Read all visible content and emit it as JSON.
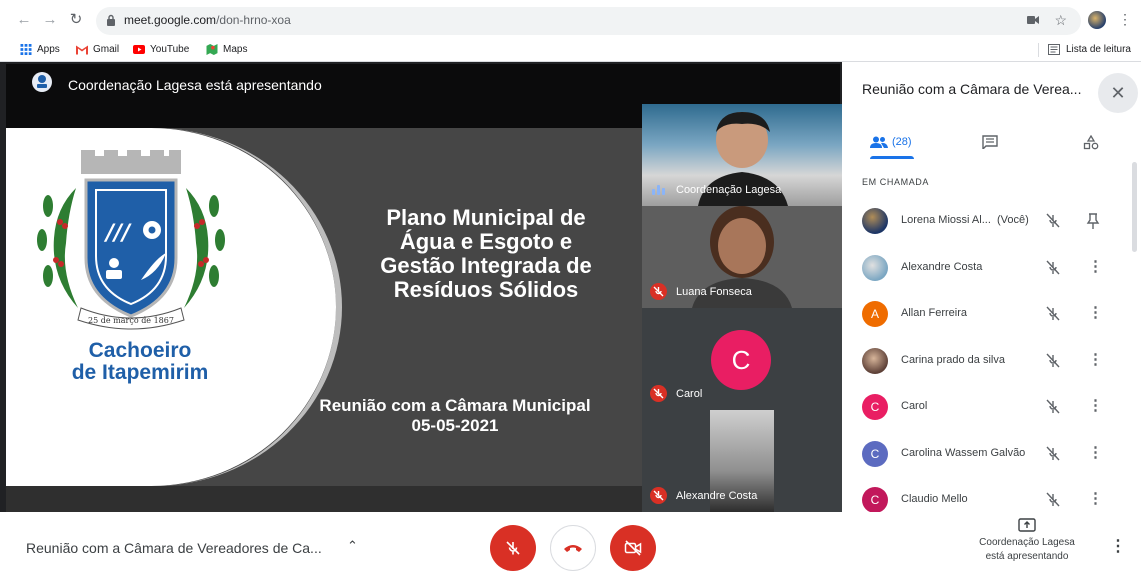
{
  "browser": {
    "url_host": "meet.google.com",
    "url_path": "/don-hrno-xoa",
    "bookmarks": [
      {
        "label": "Apps",
        "icon": "apps-grid-icon"
      },
      {
        "label": "Gmail",
        "icon": "gmail-icon"
      },
      {
        "label": "YouTube",
        "icon": "youtube-icon"
      },
      {
        "label": "Maps",
        "icon": "maps-icon"
      }
    ],
    "reading_list": "Lista de leitura"
  },
  "presentation": {
    "banner": "Coordenação Lagesa está apresentando",
    "city_line1": "Cachoeiro",
    "city_line2": "de Itapemirim",
    "crest_ribbon": "25 de março de 1867",
    "title_lines": [
      "Plano Municipal de",
      "Água e Esgoto e",
      "Gestão Integrada de",
      "Resíduos Sólidos"
    ],
    "subtitle_line1": "Reunião com a Câmara Municipal",
    "subtitle_line2": "05-05-2021"
  },
  "tiles": [
    {
      "name": "Coordenação Lagesa",
      "state": "speaking"
    },
    {
      "name": "Luana Fonseca",
      "state": "muted"
    },
    {
      "name": "Carol",
      "state": "muted",
      "initial": "C",
      "color": "#e91e63"
    },
    {
      "name": "Alexandre Costa",
      "state": "muted"
    }
  ],
  "panel": {
    "title": "Reunião com a Câmara de Verea...",
    "people_count": "(28)",
    "section": "EM CHAMADA",
    "participants": [
      {
        "name": "Lorena Miossi Al...",
        "suffix": "(Você)",
        "avatar": "photo",
        "color": "#1c3566",
        "action": "pin"
      },
      {
        "name": "Alexandre Costa",
        "avatar": "photo",
        "color": "#7aa6c2",
        "action": "more"
      },
      {
        "name": "Allan Ferreira",
        "avatar": "A",
        "color": "#ef6c00",
        "action": "more"
      },
      {
        "name": "Carina prado da silva",
        "avatar": "photo",
        "color": "#8d6e63",
        "action": "more"
      },
      {
        "name": "Carol",
        "avatar": "C",
        "color": "#e91e63",
        "action": "more"
      },
      {
        "name": "Carolina Wassem Galvão",
        "avatar": "C",
        "color": "#5c6bc0",
        "action": "more"
      },
      {
        "name": "Claudio Mello",
        "avatar": "C",
        "color": "#c2185b",
        "action": "more"
      }
    ]
  },
  "bottom": {
    "meeting_title": "Reunião com a Câmara de Vereadores de Ca...",
    "presenting_line1": "Coordenação Lagesa",
    "presenting_line2": "está apresentando"
  },
  "colors": {
    "danger": "#d93025",
    "accent": "#1a73e8"
  }
}
